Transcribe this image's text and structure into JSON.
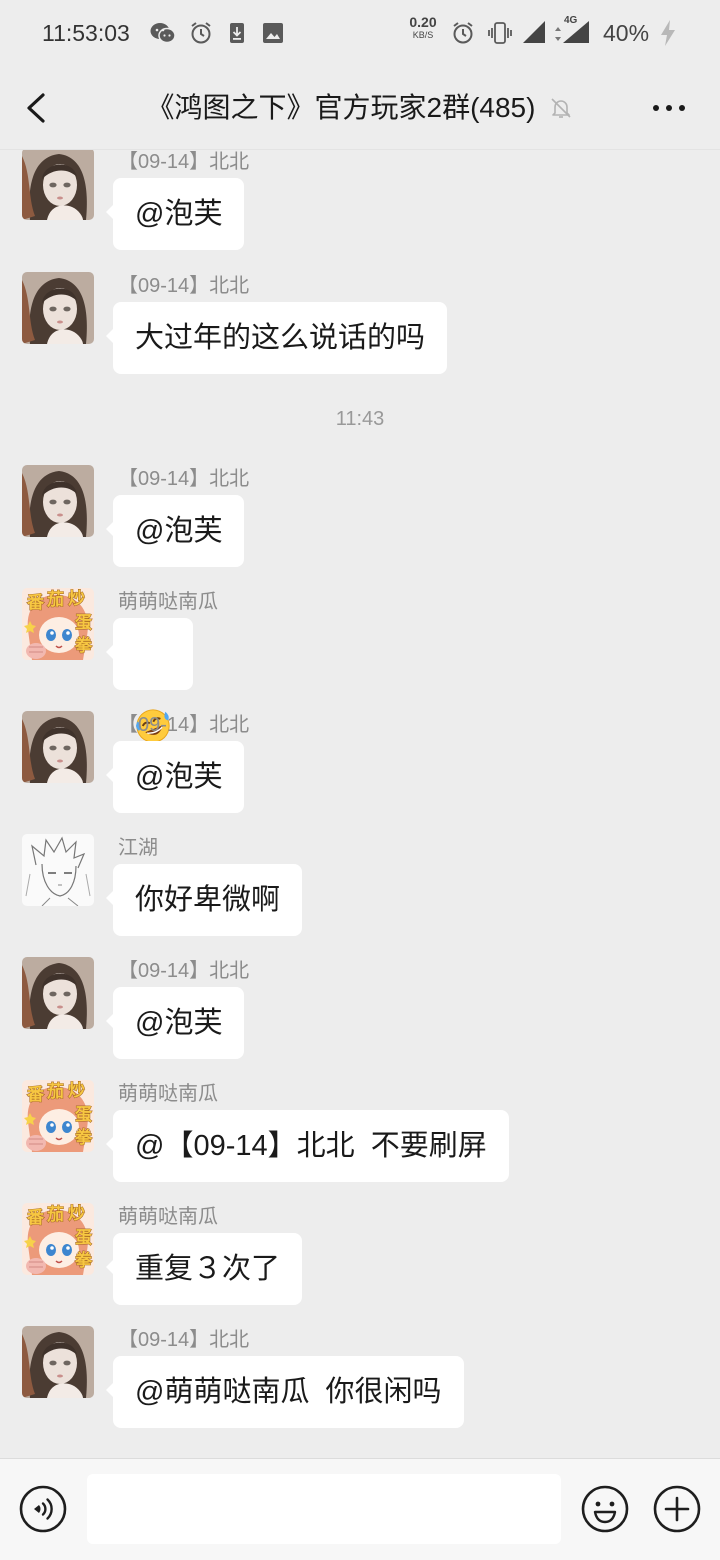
{
  "status_bar": {
    "time": "11:53:03",
    "left_icons": [
      "wechat-icon",
      "alarm-icon",
      "download-icon",
      "image-icon"
    ],
    "net_speed": {
      "value": "0.20",
      "unit": "KB/S"
    },
    "right_icons": [
      "alarm-icon",
      "vibrate-icon",
      "signal-icon",
      "signal-4g-icon",
      "charging-icon"
    ],
    "network": "4G",
    "battery": "40%"
  },
  "header": {
    "title": "《鸿图之下》官方玩家2群(485)",
    "icons": {
      "back": "chevron-left-icon",
      "mute": "bell-off-icon",
      "more": "more-dots-icon"
    }
  },
  "chat": {
    "items": [
      {
        "type": "message",
        "sender": "【09-14】北北",
        "text": "@泡芙"
      },
      {
        "type": "message",
        "sender": "【09-14】北北",
        "text": "大过年的这么说话的吗"
      },
      {
        "type": "time",
        "text": "11:43"
      },
      {
        "type": "message",
        "sender": "【09-14】北北",
        "text": "@泡芙"
      },
      {
        "type": "emoji",
        "sender": "萌萌哒南瓜",
        "avatar_lettering": [
          "番",
          "茄",
          "炒",
          "蛋",
          "拳"
        ],
        "emoji": "rolling-on-floor-laughing-emoji"
      },
      {
        "type": "message",
        "sender": "【09-14】北北",
        "text": "@泡芙"
      },
      {
        "type": "message",
        "sender": "江湖",
        "text": "你好卑微啊"
      },
      {
        "type": "message",
        "sender": "【09-14】北北",
        "text": "@泡芙"
      },
      {
        "type": "message",
        "sender": "萌萌哒南瓜",
        "avatar_lettering": [
          "番",
          "茄",
          "炒",
          "蛋",
          "拳"
        ],
        "text": "@【09-14】北北  不要刷屏"
      },
      {
        "type": "message",
        "sender": "萌萌哒南瓜",
        "avatar_lettering": [
          "番",
          "茄",
          "炒",
          "蛋",
          "拳"
        ],
        "text": "重复３次了"
      },
      {
        "type": "message",
        "sender": "【09-14】北北",
        "text": "@萌萌哒南瓜  你很闲吗"
      }
    ]
  },
  "input_bar": {
    "value": "",
    "icons": {
      "voice": "voice-icon",
      "emoji": "emoji-icon",
      "more": "plus-icon"
    }
  },
  "colors": {
    "page_background": "#ededed",
    "bubble": "#ffffff",
    "message_text": "#1a1a1a",
    "sender_name": "#8c8c8c",
    "timestamp": "#999999",
    "input_bar": "#f7f7f7"
  }
}
